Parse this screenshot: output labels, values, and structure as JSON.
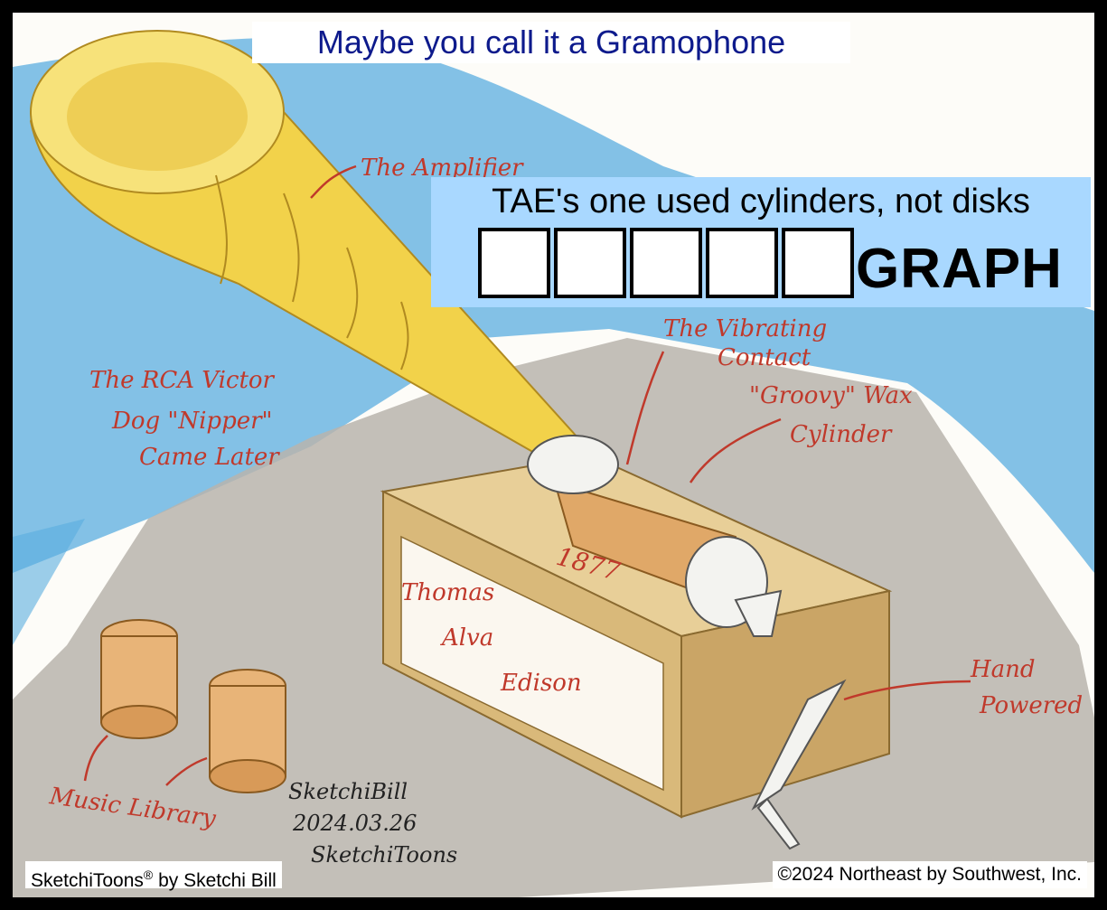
{
  "title": "Maybe you call it a Gramophone",
  "clue": {
    "text": "TAE's one used cylinders, not disks",
    "answer_length": 5,
    "suffix": "GRAPH"
  },
  "annotations": {
    "amplifier": "The Amplifier",
    "vibrating_1": "The Vibrating",
    "vibrating_2": "Contact",
    "groovy_1": "\"Groovy\" Wax",
    "groovy_2": "Cylinder",
    "rca_1": "The RCA Victor",
    "rca_2": "Dog \"Nipper\"",
    "rca_3": "Came Later",
    "year": "1877",
    "plate_1": "Thomas",
    "plate_2": "Alva",
    "plate_3": "Edison",
    "hand_1": "Hand",
    "hand_2": "Powered",
    "music_library": "Music Library"
  },
  "signature": {
    "name": "SketchiBill",
    "date": "2024.03.26",
    "brand": "SketchiToons"
  },
  "footer": {
    "left_brand": "SketchiToons",
    "left_mark": "®",
    "left_suffix": " by Sketchi Bill",
    "right": "©2024 Northeast by Southwest, Inc."
  },
  "colors": {
    "title": "#0d1a8c",
    "clue_background": "#a9d8ff",
    "annotation": "#c0392b",
    "sky": "#5aaee0",
    "horn": "#f2d24a",
    "base": "#d9b97a",
    "cylinder": "#e0a868"
  }
}
